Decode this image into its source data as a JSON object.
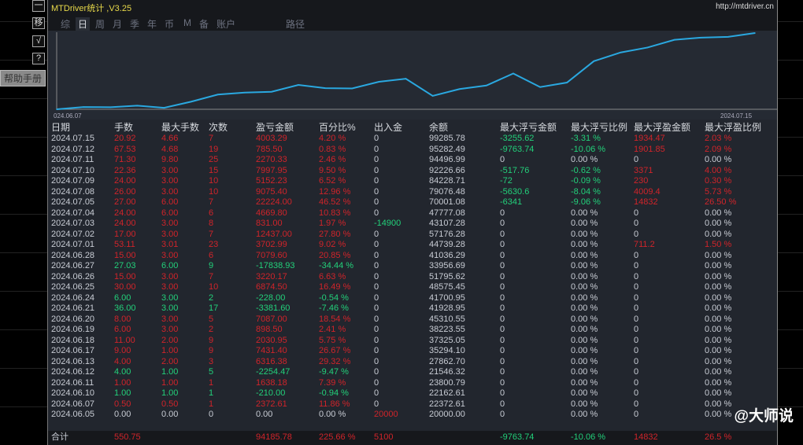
{
  "window": {
    "title": "MTDriver统计 ,V3.25",
    "url": "http://mtdriver.cn"
  },
  "side_buttons": [
    "一",
    "移",
    "√",
    "?"
  ],
  "tabs": [
    "综",
    "日",
    "周",
    "月",
    "季",
    "年",
    "币",
    "M",
    "备",
    "账户",
    "路径"
  ],
  "active_tab": "日",
  "help_button": "帮助手册",
  "chart_data": {
    "type": "line",
    "x_start_label": "024.06.07",
    "x_end_label": "2024.07.15",
    "dates": [
      "2024.06.05",
      "2024.06.07",
      "2024.06.10",
      "2024.06.11",
      "2024.06.12",
      "2024.06.13",
      "2024.06.17",
      "2024.06.18",
      "2024.06.19",
      "2024.06.20",
      "2024.06.21",
      "2024.06.24",
      "2024.06.25",
      "2024.06.26",
      "2024.06.27",
      "2024.06.28",
      "2024.07.01",
      "2024.07.02",
      "2024.07.03",
      "2024.07.04",
      "2024.07.05",
      "2024.07.08",
      "2024.07.09",
      "2024.07.10",
      "2024.07.11",
      "2024.07.12",
      "2024.07.15"
    ],
    "values": [
      20000,
      22372.61,
      22162.61,
      23800.79,
      21546.32,
      27862.7,
      35294.1,
      37325.05,
      38223.55,
      45310.55,
      41928.95,
      41700.95,
      48575.45,
      51795.62,
      33956.69,
      41036.29,
      44739.28,
      57176.28,
      43107.28,
      47777.08,
      70001.08,
      79076.48,
      84228.71,
      92226.66,
      94496.99,
      95282.49,
      99285.78
    ],
    "line_color": "#2aa8e0"
  },
  "table": {
    "headers": [
      "日期",
      "手数",
      "最大手数",
      "次数",
      "盈亏金额",
      "百分比%",
      "出入金",
      "余额",
      "最大浮亏金额",
      "最大浮亏比例",
      "最大浮盈金额",
      "最大浮盈比例"
    ],
    "rows": [
      [
        "2024.07.15",
        "20.92",
        "4.66",
        "7",
        "4003.29",
        "4.20 %",
        "0",
        "99285.78",
        "-3255.62",
        "-3.31 %",
        "1934.47",
        "2.03 %",
        "r"
      ],
      [
        "2024.07.12",
        "67.53",
        "4.68",
        "19",
        "785.50",
        "0.83 %",
        "0",
        "95282.49",
        "-9763.74",
        "-10.06 %",
        "1901.85",
        "2.09 %",
        "r"
      ],
      [
        "2024.07.11",
        "71.30",
        "9.80",
        "25",
        "2270.33",
        "2.46 %",
        "0",
        "94496.99",
        "0",
        "0.00 %",
        "0",
        "0.00 %",
        "r"
      ],
      [
        "2024.07.10",
        "22.36",
        "3.00",
        "15",
        "7997.95",
        "9.50 %",
        "0",
        "92226.66",
        "-517.76",
        "-0.62 %",
        "3371",
        "4.00 %",
        "r"
      ],
      [
        "2024.07.09",
        "24.00",
        "3.00",
        "10",
        "5152.23",
        "6.52 %",
        "0",
        "84228.71",
        "-72",
        "-0.09 %",
        "230",
        "0.30 %",
        "r"
      ],
      [
        "2024.07.08",
        "26.00",
        "3.00",
        "10",
        "9075.40",
        "12.96 %",
        "0",
        "79076.48",
        "-5630.6",
        "-8.04 %",
        "4009.4",
        "5.73 %",
        "r"
      ],
      [
        "2024.07.05",
        "27.00",
        "6.00",
        "7",
        "22224.00",
        "46.52 %",
        "0",
        "70001.08",
        "-6341",
        "-9.06 %",
        "14832",
        "26.50 %",
        "r"
      ],
      [
        "2024.07.04",
        "24.00",
        "6.00",
        "6",
        "4669.80",
        "10.83 %",
        "0",
        "47777.08",
        "0",
        "0.00 %",
        "0",
        "0.00 %",
        "r"
      ],
      [
        "2024.07.03",
        "24.00",
        "3.00",
        "8",
        "831.00",
        "1.97 %",
        "-14900",
        "43107.28",
        "0",
        "0.00 %",
        "0",
        "0.00 %",
        "r"
      ],
      [
        "2024.07.02",
        "17.00",
        "3.00",
        "7",
        "12437.00",
        "27.80 %",
        "0",
        "57176.28",
        "0",
        "0.00 %",
        "0",
        "0.00 %",
        "r"
      ],
      [
        "2024.07.01",
        "53.11",
        "3.01",
        "23",
        "3702.99",
        "9.02 %",
        "0",
        "44739.28",
        "0",
        "0.00 %",
        "711.2",
        "1.50 %",
        "r"
      ],
      [
        "2024.06.28",
        "15.00",
        "3.00",
        "6",
        "7079.60",
        "20.85 %",
        "0",
        "41036.29",
        "0",
        "0.00 %",
        "0",
        "0.00 %",
        "r"
      ],
      [
        "2024.06.27",
        "27.03",
        "6.00",
        "9",
        "-17838.93",
        "-34.44 %",
        "0",
        "33956.69",
        "0",
        "0.00 %",
        "0",
        "0.00 %",
        "g"
      ],
      [
        "2024.06.26",
        "15.00",
        "3.00",
        "7",
        "3220.17",
        "6.63 %",
        "0",
        "51795.62",
        "0",
        "0.00 %",
        "0",
        "0.00 %",
        "r"
      ],
      [
        "2024.06.25",
        "30.00",
        "3.00",
        "10",
        "6874.50",
        "16.49 %",
        "0",
        "48575.45",
        "0",
        "0.00 %",
        "0",
        "0.00 %",
        "r"
      ],
      [
        "2024.06.24",
        "6.00",
        "3.00",
        "2",
        "-228.00",
        "-0.54 %",
        "0",
        "41700.95",
        "0",
        "0.00 %",
        "0",
        "0.00 %",
        "g"
      ],
      [
        "2024.06.21",
        "36.00",
        "3.00",
        "17",
        "-3381.60",
        "-7.46 %",
        "0",
        "41928.95",
        "0",
        "0.00 %",
        "0",
        "0.00 %",
        "g"
      ],
      [
        "2024.06.20",
        "8.00",
        "3.00",
        "5",
        "7087.00",
        "18.54 %",
        "0",
        "45310.55",
        "0",
        "0.00 %",
        "0",
        "0.00 %",
        "r"
      ],
      [
        "2024.06.19",
        "6.00",
        "3.00",
        "2",
        "898.50",
        "2.41 %",
        "0",
        "38223.55",
        "0",
        "0.00 %",
        "0",
        "0.00 %",
        "r"
      ],
      [
        "2024.06.18",
        "11.00",
        "2.00",
        "9",
        "2030.95",
        "5.75 %",
        "0",
        "37325.05",
        "0",
        "0.00 %",
        "0",
        "0.00 %",
        "r"
      ],
      [
        "2024.06.17",
        "9.00",
        "1.00",
        "9",
        "7431.40",
        "26.67 %",
        "0",
        "35294.10",
        "0",
        "0.00 %",
        "0",
        "0.00 %",
        "r"
      ],
      [
        "2024.06.13",
        "4.00",
        "2.00",
        "3",
        "6316.38",
        "29.32 %",
        "0",
        "27862.70",
        "0",
        "0.00 %",
        "0",
        "0.00 %",
        "r"
      ],
      [
        "2024.06.12",
        "4.00",
        "1.00",
        "5",
        "-2254.47",
        "-9.47 %",
        "0",
        "21546.32",
        "0",
        "0.00 %",
        "0",
        "0.00 %",
        "g"
      ],
      [
        "2024.06.11",
        "1.00",
        "1.00",
        "1",
        "1638.18",
        "7.39 %",
        "0",
        "23800.79",
        "0",
        "0.00 %",
        "0",
        "0.00 %",
        "r"
      ],
      [
        "2024.06.10",
        "1.00",
        "1.00",
        "1",
        "-210.00",
        "-0.94 %",
        "0",
        "22162.61",
        "0",
        "0.00 %",
        "0",
        "0.00 %",
        "g"
      ],
      [
        "2024.06.07",
        "0.50",
        "0.50",
        "1",
        "2372.61",
        "11.86 %",
        "0",
        "22372.61",
        "0",
        "0.00 %",
        "0",
        "0.00 %",
        "r"
      ],
      [
        "2024.06.05",
        "0.00",
        "0.00",
        "0",
        "0.00",
        "0.00 %",
        "20000",
        "20000.00",
        "0",
        "0.00 %",
        "0",
        "0.00 %",
        "n"
      ]
    ],
    "total": [
      "合计",
      "550.75",
      "",
      "",
      "94185.78",
      "225.66 %",
      "5100",
      "",
      "-9763.74",
      "-10.06 %",
      "14832",
      "26.5 %"
    ]
  },
  "watermark": "@大师说",
  "colors": {
    "profit": "#d0242a",
    "loss": "#22d07a",
    "panel": "#22262e"
  }
}
